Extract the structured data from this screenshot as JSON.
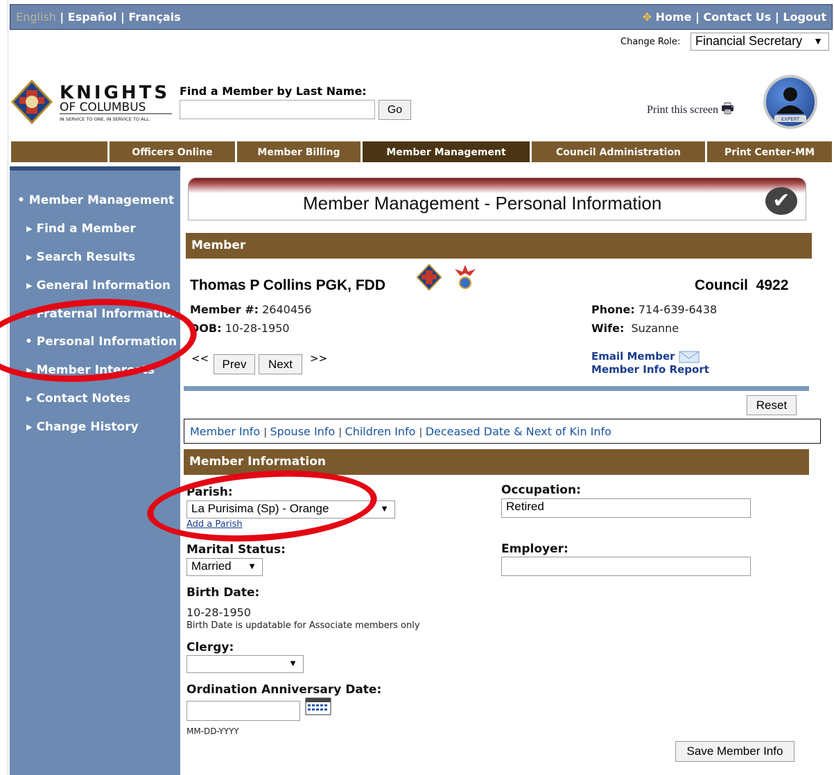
{
  "top_bar": {
    "languages": [
      "English",
      "Español",
      "Français"
    ],
    "links": [
      "Home",
      "Contact Us",
      "Logout"
    ]
  },
  "role": {
    "label": "Change Role:",
    "value": "Financial Secretary"
  },
  "logo": {
    "line1": "KNIGHTS",
    "line2": "OF COLUMBUS",
    "tagline": "IN SERVICE TO ONE. IN SERVICE TO ALL."
  },
  "search": {
    "label": "Find a Member by Last Name:",
    "value": "",
    "button": "Go"
  },
  "print_link": "Print this screen",
  "badge_text": "EXPERT",
  "nav": [
    "Officers Online",
    "Member Billing",
    "Member Management",
    "Council Administration",
    "Print Center-MM"
  ],
  "sidebar": {
    "items": [
      "Member Management",
      "Find a Member",
      "Search Results",
      "General Information",
      "Fraternal Information",
      "Personal Information",
      "Member Interests",
      "Contact Notes",
      "Change History"
    ]
  },
  "page_title": "Member Management - Personal Information",
  "member_section": {
    "title": "Member",
    "name": "Thomas  P  Collins PGK, FDD",
    "council_label": "Council",
    "council_number": "4922",
    "member_no_label": "Member #:",
    "member_no": "2640456",
    "dob_label": "DOB:",
    "dob": "10-28-1950",
    "phone_label": "Phone:",
    "phone": "714-639-6438",
    "wife_label": "Wife:",
    "wife": "Suzanne",
    "prev_symbol": "<<",
    "prev": "Prev",
    "next": "Next",
    "next_symbol": ">>",
    "email_link": "Email Member",
    "report_link": "Member Info Report",
    "reset": "Reset"
  },
  "subtabs": [
    "Member Info",
    "Spouse Info",
    "Children Info",
    "Deceased Date & Next of Kin Info"
  ],
  "member_info": {
    "title": "Member Information",
    "parish_label": "Parish:",
    "parish_value": "La Purisima (Sp) - Orange",
    "add_parish": "Add a Parish",
    "occupation_label": "Occupation:",
    "occupation_value": "Retired",
    "marital_label": "Marital Status:",
    "marital_value": "Married",
    "employer_label": "Employer:",
    "employer_value": "",
    "birth_label": "Birth Date:",
    "birth_value": "10-28-1950",
    "birth_note": "Birth Date is updatable for Associate members only",
    "clergy_label": "Clergy:",
    "clergy_value": "",
    "ordination_label": "Ordination Anniversary Date:",
    "ordination_value": "",
    "date_format": "MM-DD-YYYY",
    "save": "Save Member Info"
  },
  "colors": {
    "nav_brown": "#7a5a2d",
    "sidebar_blue": "#6c8ab2",
    "annotation_red": "#e30613"
  }
}
